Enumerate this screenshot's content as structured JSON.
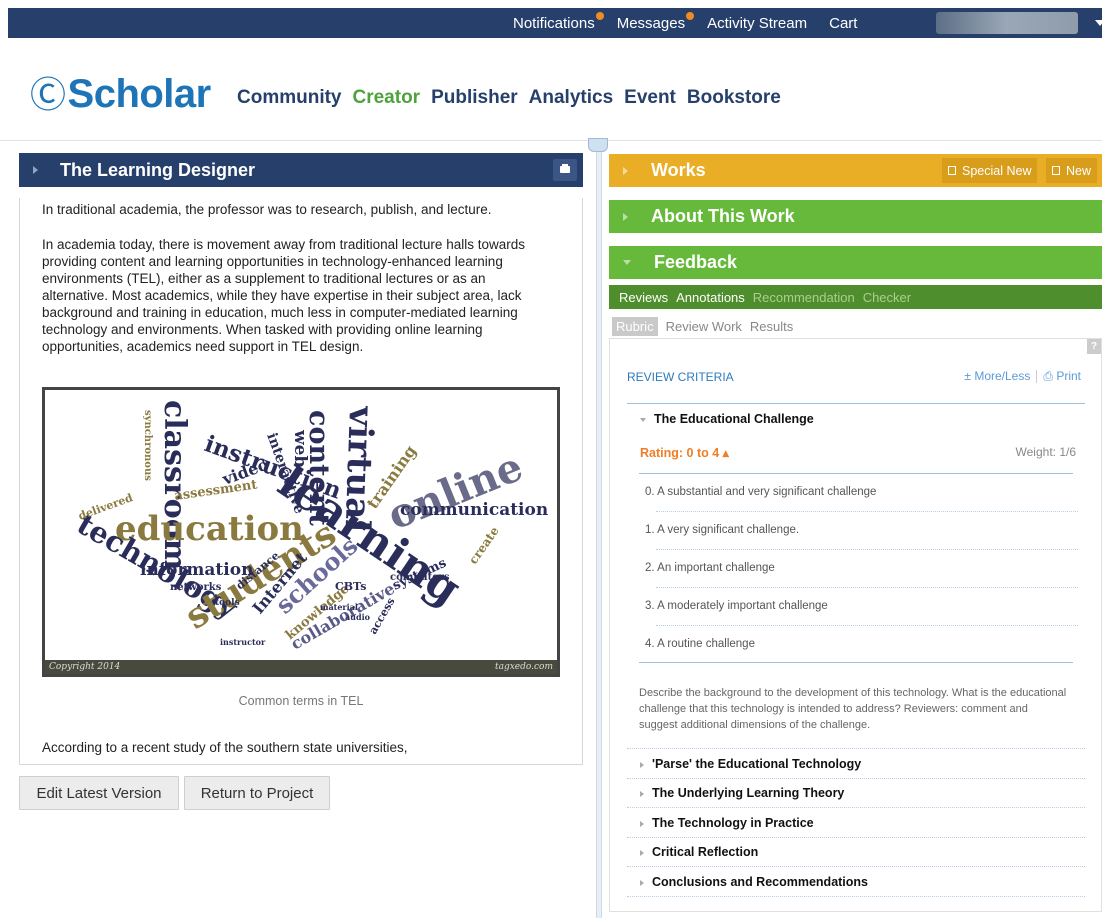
{
  "topbar": {
    "items": [
      {
        "label": "Notifications",
        "badge": true
      },
      {
        "label": "Messages",
        "badge": true
      },
      {
        "label": "Activity Stream",
        "badge": false
      },
      {
        "label": "Cart",
        "badge": false
      }
    ]
  },
  "brand": {
    "logo_text": "Scholar",
    "logo_mark": "Ⓒ"
  },
  "nav": {
    "community": "Community",
    "creator": "Creator",
    "publisher": "Publisher",
    "analytics": "Analytics",
    "event": "Event",
    "bookstore": "Bookstore",
    "active": "Creator"
  },
  "left_panel": {
    "title": "The Learning Designer",
    "paragraph1": "In traditional academia, the professor was to research, publish, and lecture.",
    "paragraph2": "In academia today, there is movement away from traditional lecture halls towards providing content and learning opportunities in technology-enhanced learning environments (TEL), either as a supplement to traditional lectures or as an alternative. Most academics, while they have expertise in their subject area, lack background and training in education, much less in computer-mediated learning technology and environments. When tasked with providing online learning opportunities, academics need support in TEL design.",
    "image_caption": "Common terms in TEL",
    "image_copyright": "Copyright 2014",
    "image_credit": "tagxedo.com",
    "paragraph3": "According to a recent study of the southern state universities,",
    "cloud_words": [
      "classroom",
      "instruction",
      "education",
      "technology",
      "learning",
      "online",
      "students",
      "virtual",
      "content",
      "communication",
      "information",
      "schools",
      "Internet",
      "collaborative",
      "training",
      "web",
      "video",
      "interactive",
      "assessment",
      "knowledge",
      "systems",
      "networks",
      "delivered",
      "synchronous",
      "access",
      "computers",
      "CBTs",
      "distance",
      "instructor",
      "create",
      "material",
      "tools",
      "audio"
    ]
  },
  "buttons": {
    "edit_latest": "Edit Latest Version",
    "return_project": "Return to Project"
  },
  "right_panel": {
    "works_title": "Works",
    "special_new": "Special New",
    "new_label": "New",
    "about_title": "About This Work",
    "feedback_title": "Feedback",
    "tabs": [
      "Reviews",
      "Annotations",
      "Recommendation",
      "Checker"
    ],
    "subtabs": [
      "Rubric",
      "Review Work",
      "Results"
    ],
    "help": "?",
    "review_criteria": "REVIEW CRITERIA",
    "more_less": "± More/Less",
    "print": "Print",
    "current_section": "The Educational Challenge",
    "rating_label": "Rating: 0 to 4 ▴",
    "weight_label": "Weight: 1/6",
    "ratings": [
      "0. A substantial and very significant challenge",
      "1. A very significant challenge.",
      "2. An important challenge",
      "3. A moderately important challenge",
      "4. A routine challenge"
    ],
    "description": "Describe the background to the development of this technology. What is the educational challenge that this technology is intended to address? Reviewers: comment and suggest additional dimensions of the challenge.",
    "sections": [
      "'Parse' the Educational Technology",
      "The Underlying Learning Theory",
      "The Technology in Practice",
      "Critical Reflection",
      "Conclusions and Recommendations"
    ]
  },
  "colors": {
    "navy": "#26406b",
    "green": "#66b93a",
    "dark_green": "#4f8e2c",
    "gold": "#e9ad26",
    "orange": "#f07e26",
    "link_blue": "#2c7bbd"
  }
}
